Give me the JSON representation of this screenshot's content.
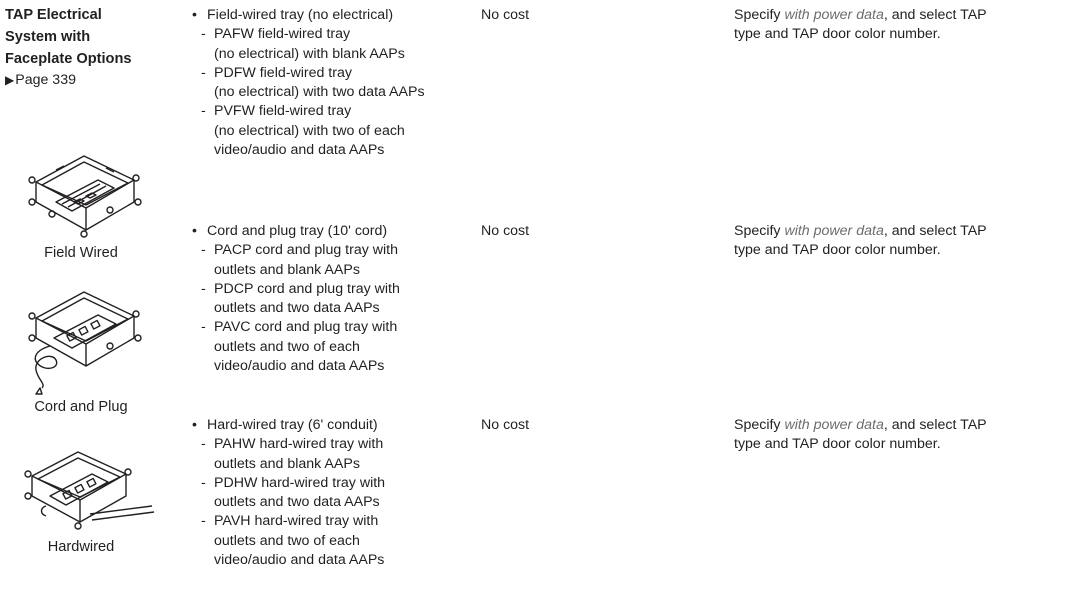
{
  "heading": {
    "title_line1": "TAP Electrical",
    "title_line2": "System with",
    "title_line3": "Faceplate Options",
    "page_ref": "Page 339"
  },
  "illustrations": [
    {
      "icon": "tap-tray-field-wired-illustration",
      "caption": "Field Wired"
    },
    {
      "icon": "tap-tray-cord-and-plug-illustration",
      "caption": "Cord and Plug"
    },
    {
      "icon": "tap-tray-hardwired-illustration",
      "caption": "Hardwired"
    }
  ],
  "options": [
    {
      "label": "Field-wired tray (no electrical)",
      "cost": "No cost",
      "note_prefix": "Specify ",
      "note_emph": "with power data",
      "note_suffix": ", and select TAP",
      "note_line2": "type and TAP door color number.",
      "items": [
        {
          "lines": [
            "PAFW field-wired tray",
            "(no electrical) with blank AAPs"
          ]
        },
        {
          "lines": [
            "PDFW field-wired tray",
            "(no electrical) with two data AAPs"
          ]
        },
        {
          "lines": [
            "PVFW field-wired tray",
            "(no electrical) with two of each",
            "video/audio and data AAPs"
          ]
        }
      ]
    },
    {
      "label": "Cord and plug tray (10' cord)",
      "cost": "No cost",
      "note_prefix": "Specify ",
      "note_emph": "with power data",
      "note_suffix": ", and select TAP",
      "note_line2": "type and TAP door color number.",
      "items": [
        {
          "lines": [
            "PACP cord and plug tray with",
            "outlets and blank AAPs"
          ]
        },
        {
          "lines": [
            "PDCP cord and plug tray with",
            "outlets and two data AAPs"
          ]
        },
        {
          "lines": [
            "PAVC cord and plug tray with",
            "outlets and two of each",
            "video/audio and data AAPs"
          ]
        }
      ]
    },
    {
      "label": "Hard-wired tray (6' conduit)",
      "cost": "No cost",
      "note_prefix": "Specify ",
      "note_emph": "with power data",
      "note_suffix": ", and select TAP",
      "note_line2": "type and TAP door color number.",
      "items": [
        {
          "lines": [
            "PAHW hard-wired tray with",
            "outlets and blank AAPs"
          ]
        },
        {
          "lines": [
            "PDHW hard-wired tray with",
            "outlets and two data AAPs"
          ]
        },
        {
          "lines": [
            "PAVH hard-wired tray with",
            "outlets and two of each",
            "video/audio and data AAPs"
          ]
        }
      ]
    }
  ]
}
